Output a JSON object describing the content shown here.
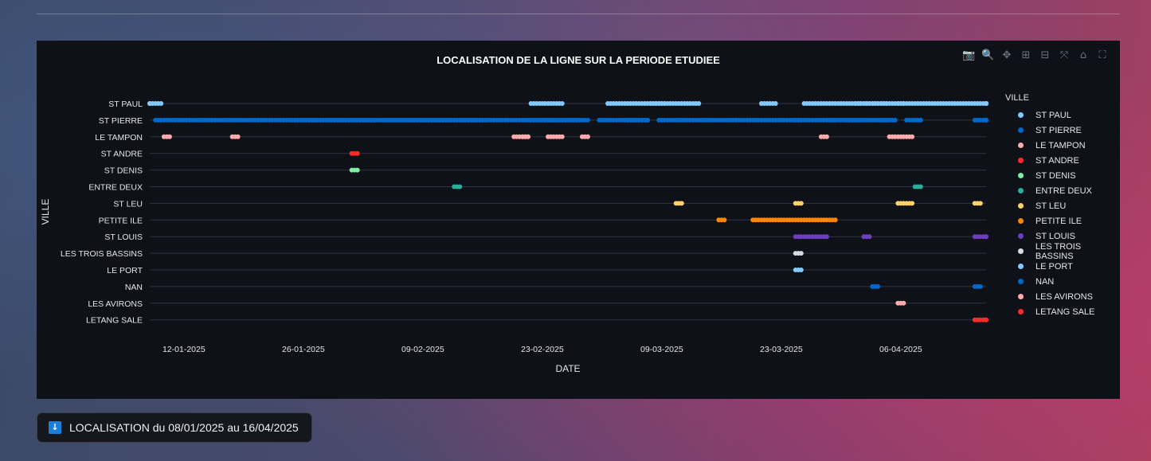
{
  "download_button": {
    "icon": "down-arrow-icon",
    "label": "LOCALISATION du 08/01/2025 au 16/04/2025"
  },
  "modebar": {
    "buttons": [
      {
        "name": "camera-icon",
        "glyph": "📷"
      },
      {
        "name": "zoom-icon",
        "glyph": "🔍"
      },
      {
        "name": "pan-icon",
        "glyph": "✥"
      },
      {
        "name": "zoom-in-icon",
        "glyph": "⊞"
      },
      {
        "name": "zoom-out-icon",
        "glyph": "⊟"
      },
      {
        "name": "autoscale-icon",
        "glyph": "⤧"
      },
      {
        "name": "home-icon",
        "glyph": "⌂"
      },
      {
        "name": "fullscreen-icon",
        "glyph": "⛶"
      }
    ]
  },
  "chart_data": {
    "type": "scatter",
    "title": "LOCALISATION DE LA LIGNE SUR LA PERIODE ETUDIEE",
    "xlabel": "DATE",
    "ylabel": "VILLE",
    "legend_title": "VILLE",
    "legend_position": "right",
    "xlim": [
      "2025-01-08",
      "2025-04-16"
    ],
    "x_ticks": [
      "2025-01-12",
      "2025-01-26",
      "2025-02-09",
      "2025-02-23",
      "2025-03-09",
      "2025-03-23",
      "2025-04-06"
    ],
    "x_tick_labels": [
      "12-01-2025",
      "26-01-2025",
      "09-02-2025",
      "23-02-2025",
      "09-03-2025",
      "23-03-2025",
      "06-04-2025"
    ],
    "categories": [
      "ST PAUL",
      "ST PIERRE",
      "LE TAMPON",
      "ST ANDRE",
      "ST DENIS",
      "ENTRE DEUX",
      "ST LEU",
      "PETITE ILE",
      "ST LOUIS",
      "LES TROIS BASSINS",
      "LE PORT",
      "NAN",
      "LES AVIRONS",
      "LETANG SALE"
    ],
    "grid": "horizontal",
    "series": [
      {
        "name": "ST PAUL",
        "color": "#83c9ff",
        "points": [
          [
            "2025-01-08",
            2
          ],
          [
            "2025-02-22",
            2
          ],
          [
            "2025-02-24",
            2
          ],
          [
            "2025-03-03",
            7
          ],
          [
            "2025-03-08",
            6
          ],
          [
            "2025-03-21",
            2
          ],
          [
            "2025-03-26",
            3
          ],
          [
            "2025-03-29",
            7
          ],
          [
            "2025-04-01",
            3
          ],
          [
            "2025-04-04",
            3
          ],
          [
            "2025-04-06",
            1
          ],
          [
            "2025-04-07",
            1
          ],
          [
            "2025-04-08",
            17
          ]
        ]
      },
      {
        "name": "ST PIERRE",
        "color": "#0068c9",
        "points": [
          [
            "2025-01-09",
            35
          ],
          [
            "2025-01-25",
            10
          ],
          [
            "2025-02-05",
            12
          ],
          [
            "2025-02-09",
            19
          ],
          [
            "2025-02-22",
            3
          ],
          [
            "2025-02-24",
            5
          ],
          [
            "2025-03-02",
            6
          ],
          [
            "2025-03-05",
            2
          ],
          [
            "2025-03-07",
            1
          ],
          [
            "2025-03-09",
            17
          ],
          [
            "2025-03-25",
            8
          ],
          [
            "2025-03-29",
            1
          ],
          [
            "2025-03-31",
            5
          ],
          [
            "2025-04-04",
            2
          ],
          [
            "2025-04-07",
            2
          ],
          [
            "2025-04-15",
            3
          ]
        ]
      },
      {
        "name": "LE TAMPON",
        "color": "#ffabab",
        "points": [
          [
            "2025-01-10",
            1
          ],
          [
            "2025-01-18",
            1
          ],
          [
            "2025-02-20",
            2
          ],
          [
            "2025-02-21",
            1
          ],
          [
            "2025-02-24",
            1
          ],
          [
            "2025-02-25",
            1
          ],
          [
            "2025-02-28",
            1
          ],
          [
            "2025-03-28",
            1
          ],
          [
            "2025-04-05",
            1
          ],
          [
            "2025-04-06",
            1
          ],
          [
            "2025-04-07",
            1
          ]
        ]
      },
      {
        "name": "ST ANDRE",
        "color": "#ff2b2b",
        "points": [
          [
            "2025-02-01",
            1
          ]
        ]
      },
      {
        "name": "ST DENIS",
        "color": "#7defa1",
        "points": [
          [
            "2025-02-01",
            1
          ]
        ]
      },
      {
        "name": "ENTRE DEUX",
        "color": "#29b09d",
        "points": [
          [
            "2025-02-13",
            1
          ],
          [
            "2025-04-08",
            1
          ]
        ]
      },
      {
        "name": "ST LEU",
        "color": "#ffd16a",
        "points": [
          [
            "2025-03-11",
            1
          ],
          [
            "2025-03-25",
            1
          ],
          [
            "2025-04-06",
            1
          ],
          [
            "2025-04-07",
            1
          ],
          [
            "2025-04-15",
            1
          ]
        ]
      },
      {
        "name": "PETITE ILE",
        "color": "#ff8700",
        "points": [
          [
            "2025-03-16",
            1
          ],
          [
            "2025-03-20",
            10
          ]
        ]
      },
      {
        "name": "ST LOUIS",
        "color": "#6d3fc0",
        "points": [
          [
            "2025-03-25",
            2
          ],
          [
            "2025-03-27",
            1
          ],
          [
            "2025-03-28",
            1
          ],
          [
            "2025-04-02",
            1
          ],
          [
            "2025-04-15",
            1
          ],
          [
            "2025-04-16",
            1
          ]
        ]
      },
      {
        "name": "LES TROIS BASSINS",
        "color": "#d5dae5",
        "points": [
          [
            "2025-03-25",
            1
          ]
        ]
      },
      {
        "name": "LE PORT",
        "color": "#83c9ff",
        "points": [
          [
            "2025-03-25",
            1
          ]
        ]
      },
      {
        "name": "NAN",
        "color": "#0068c9",
        "points": [
          [
            "2025-04-03",
            1
          ],
          [
            "2025-04-15",
            1
          ]
        ]
      },
      {
        "name": "LES AVIRONS",
        "color": "#ffabab",
        "points": [
          [
            "2025-04-06",
            1
          ]
        ]
      },
      {
        "name": "LETANG SALE",
        "color": "#ff2b2b",
        "points": [
          [
            "2025-04-15",
            1
          ],
          [
            "2025-04-16",
            1
          ]
        ]
      }
    ]
  }
}
